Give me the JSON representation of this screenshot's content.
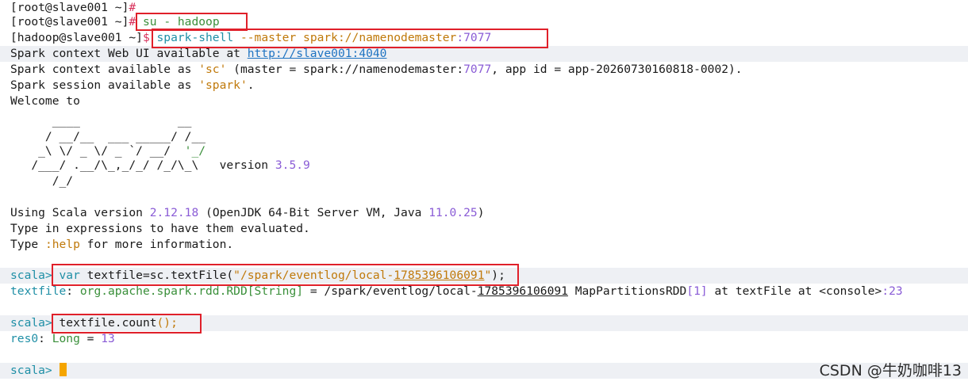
{
  "terminal": {
    "l1_prompt": "[root@slave001 ~]",
    "l1_hash": "#",
    "l2_prompt": "[root@slave001 ~]",
    "l2_hash": "#",
    "l2_cmd": " su - hadoop",
    "l3_prompt": "[hadoop@slave001 ~]",
    "l3_dollar": "$",
    "l3_cmd_a": " spark-shell",
    "l3_cmd_b": " --master",
    "l3_cmd_c": " spark://namenodemaster",
    "l3_cmd_d": ":7077",
    "l4_text": "Spark context Web UI available at ",
    "l4_link": "http://slave001:4040",
    "l5_a": "Spark context available as ",
    "l5_sc": "'sc'",
    "l5_b": " (master = spark://namenodemaster:",
    "l5_port": "7077",
    "l5_c": ", app id = app-20260730160818-0002).",
    "l6_a": "Spark session available as ",
    "l6_spark": "'spark'",
    "l6_b": ".",
    "l7": "Welcome to",
    "logo1": "      ____              __",
    "logo2": "     / __/__  ___ _____/ /__",
    "logo3a": "    _\\ \\/ _ \\/ _ `/ __/  ",
    "logo3b": "'_/",
    "logo4": "   /___/ .__/\\_,_/_/ /_/\\_\\   version ",
    "logo4v": "3.5.9",
    "logo5": "      /_/",
    "scala_a": "Using Scala version ",
    "scala_v": "2.12.18",
    "scala_b": " (OpenJDK 64-Bit Server VM, Java ",
    "scala_j": "11.0.25",
    "scala_c": ")",
    "type1": "Type in expressions to have them evaluated.",
    "type2_a": "Type ",
    "type2_help": ":help",
    "type2_b": " for more information.",
    "p1": "scala>",
    "p1_var": " var",
    "p1_a": " textfile=sc.textFile(",
    "p1_str1": "\"/spark/eventlog/local-",
    "p1_num": "1785396106091",
    "p1_str2": "\"",
    "p1_end": ");",
    "r1_name": "textfile",
    "r1_colon": ": ",
    "r1_type": "org.apache.spark.rdd.RDD[String]",
    "r1_eq": " = /spark/eventlog/local-",
    "r1_num": "1785396106091",
    "r1_a": " MapPartitionsRDD",
    "r1_idx": "[1]",
    "r1_b": " at textFile at <console>",
    "r1_line": ":23",
    "p2": "scala>",
    "p2_cmd": " textfile.count",
    "p2_paren": "();",
    "r2_name": "res0",
    "r2_colon": ": ",
    "r2_type": "Long",
    "r2_eq": " = ",
    "r2_val": "13",
    "p3": "scala>"
  },
  "watermark": "CSDN @牛奶咖啡13"
}
